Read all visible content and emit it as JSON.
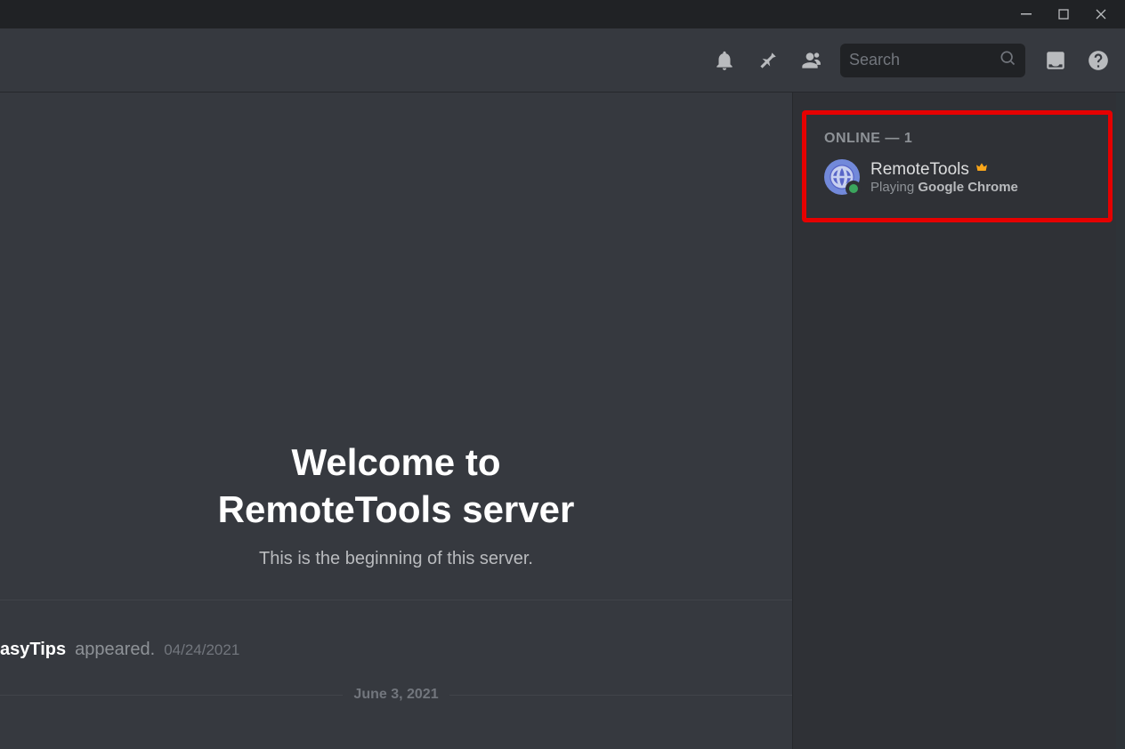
{
  "titlebar": {
    "minimize": "minimize",
    "maximize": "maximize",
    "close": "close"
  },
  "header": {
    "search_placeholder": "Search"
  },
  "welcome": {
    "title_line1": "Welcome to",
    "title_line2": "RemoteTools server",
    "subtitle": "This is the beginning of this server."
  },
  "events": {
    "appeared_name": "asyTips",
    "appeared_verb": "appeared.",
    "appeared_date": "04/24/2021"
  },
  "date_divider": "June 3, 2021",
  "members": {
    "heading": "ONLINE — 1",
    "list": [
      {
        "name": "RemoteTools",
        "is_owner": true,
        "activity_prefix": "Playing ",
        "activity_app": "Google Chrome",
        "status": "online"
      }
    ]
  },
  "highlight": {
    "color": "#e60000"
  }
}
